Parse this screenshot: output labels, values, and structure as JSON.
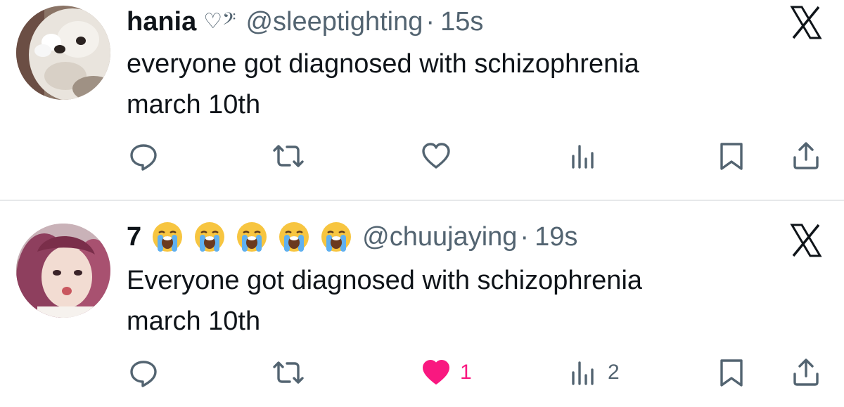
{
  "tweets": [
    {
      "display_name": "hania",
      "name_glyph": "♡𝄢",
      "handle": "@sleeptighting",
      "separator": "·",
      "time": "15s",
      "text": "everyone got diagnosed with schizophrenia\nmarch 10th",
      "avatar_icon": "puppy-avatar",
      "liked": false,
      "like_count": "",
      "view_count": ""
    },
    {
      "display_name": "7",
      "name_emojis": [
        "loudly-crying-face",
        "loudly-crying-face",
        "loudly-crying-face",
        "loudly-crying-face",
        "loudly-crying-face"
      ],
      "handle": "@chuujaying",
      "separator": "·",
      "time": "19s",
      "text": "Everyone got diagnosed with schizophrenia\nmarch 10th",
      "avatar_icon": "person-avatar",
      "liked": true,
      "like_count": "1",
      "view_count": "2"
    }
  ],
  "colors": {
    "text": "#0f1419",
    "secondary": "#536471",
    "like": "#f91880",
    "divider": "#e6e8ea"
  }
}
